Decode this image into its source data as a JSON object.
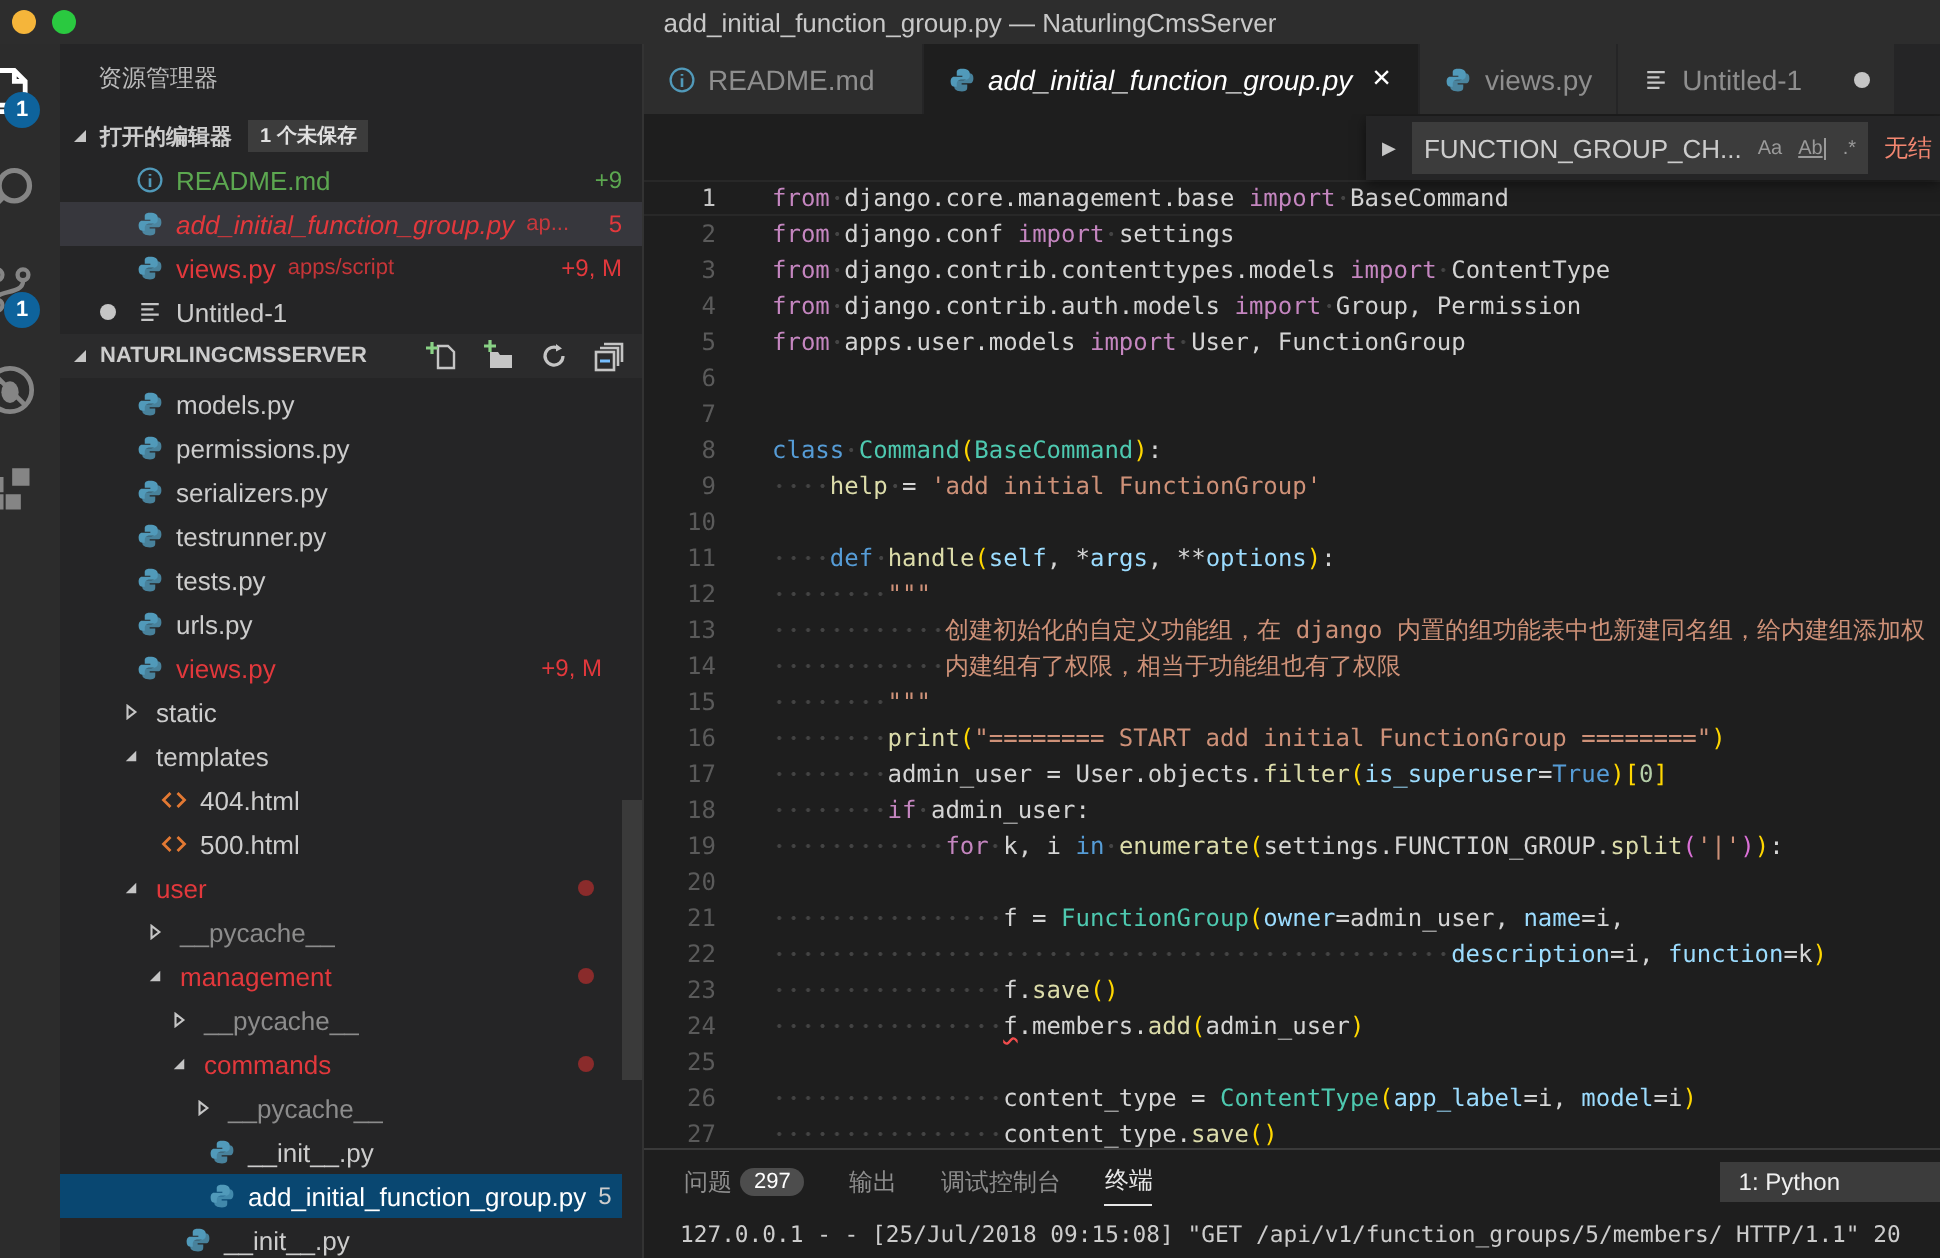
{
  "window": {
    "title": "add_initial_function_group.py — NaturlingCmsServer"
  },
  "activity_bar": [
    {
      "kind": "files",
      "badge": "1",
      "selected": true
    },
    {
      "kind": "search",
      "selected": false
    },
    {
      "kind": "git",
      "badge": "1",
      "selected": false
    },
    {
      "kind": "debug",
      "selected": false
    },
    {
      "kind": "extensions",
      "selected": false
    }
  ],
  "sidebar": {
    "title": "资源管理器",
    "open_editors": {
      "title": "打开的编辑器",
      "badge": "1 个未保存",
      "expanded": true,
      "items": [
        {
          "kind": "info",
          "name": "README.md",
          "added": true,
          "errors": false,
          "decoration": "+9",
          "preview": false,
          "dirty": false,
          "selected": false
        },
        {
          "kind": "python",
          "name": "add_initial_function_group.py",
          "path": "ap...",
          "added": false,
          "errors": true,
          "decoration": "5",
          "preview": true,
          "dirty": false,
          "selected": true
        },
        {
          "kind": "python",
          "name": "views.py",
          "path": "apps/script",
          "added": false,
          "errors": true,
          "decoration": "+9, M",
          "preview": false,
          "dirty": false,
          "selected": false
        },
        {
          "kind": "text",
          "name": "Untitled-1",
          "added": false,
          "errors": false,
          "preview": false,
          "dirty": true,
          "selected": false
        }
      ]
    },
    "project": {
      "title": "NATURLINGCMSSERVER",
      "expanded": true,
      "tree": [
        {
          "kind": "python",
          "name": "models.py",
          "errors": false,
          "ignored": false,
          "selected": false
        },
        {
          "kind": "python",
          "name": "permissions.py",
          "errors": false,
          "ignored": false,
          "selected": false
        },
        {
          "kind": "python",
          "name": "serializers.py",
          "errors": false,
          "ignored": false,
          "selected": false
        },
        {
          "kind": "python",
          "name": "testrunner.py",
          "errors": false,
          "ignored": false,
          "selected": false
        },
        {
          "kind": "python",
          "name": "tests.py",
          "errors": false,
          "ignored": false,
          "selected": false
        },
        {
          "kind": "python",
          "name": "urls.py",
          "errors": false,
          "ignored": false,
          "selected": false
        },
        {
          "kind": "python",
          "name": "views.py",
          "errors": true,
          "ignored": false,
          "decoration": "+9, M",
          "selected": false
        },
        {
          "kind": "folder",
          "name": "static",
          "errors": false,
          "ignored": false,
          "expanded": false,
          "selected": false
        },
        {
          "kind": "folder",
          "name": "templates",
          "errors": false,
          "ignored": false,
          "expanded": true,
          "selected": false,
          "children": [
            {
              "kind": "html",
              "name": "404.html",
              "errors": false,
              "ignored": false,
              "selected": false
            },
            {
              "kind": "html",
              "name": "500.html",
              "errors": false,
              "ignored": false,
              "selected": false
            }
          ]
        },
        {
          "kind": "folder",
          "name": "user",
          "errors": true,
          "ignored": false,
          "expanded": true,
          "selected": false,
          "children": [
            {
              "kind": "folder",
              "name": "__pycache__",
              "errors": false,
              "ignored": true,
              "expanded": false,
              "selected": false
            },
            {
              "kind": "folder",
              "name": "management",
              "errors": true,
              "ignored": false,
              "expanded": true,
              "selected": false,
              "children": [
                {
                  "kind": "folder",
                  "name": "__pycache__",
                  "errors": false,
                  "ignored": true,
                  "expanded": false,
                  "selected": false
                },
                {
                  "kind": "folder",
                  "name": "commands",
                  "errors": true,
                  "ignored": false,
                  "expanded": true,
                  "selected": false,
                  "children": [
                    {
                      "kind": "folder",
                      "name": "__pycache__",
                      "errors": false,
                      "ignored": true,
                      "expanded": false,
                      "selected": false
                    },
                    {
                      "kind": "python",
                      "name": "__init__.py",
                      "errors": false,
                      "ignored": false,
                      "selected": false
                    },
                    {
                      "kind": "python",
                      "name": "add_initial_function_group.py",
                      "errors": false,
                      "ignored": false,
                      "decoration": "5",
                      "selected": true
                    }
                  ]
                },
                {
                  "kind": "python",
                  "name": "__init__.py",
                  "errors": false,
                  "ignored": false,
                  "selected": false
                }
              ]
            }
          ]
        }
      ]
    }
  },
  "tabs": [
    {
      "kind": "info",
      "label": "README.md",
      "selected": false,
      "preview": false,
      "dirty": false
    },
    {
      "kind": "python",
      "label": "add_initial_function_group.py",
      "selected": true,
      "preview": true,
      "dirty": false,
      "close": "×"
    },
    {
      "kind": "python",
      "label": "views.py",
      "selected": false,
      "preview": false,
      "dirty": false
    },
    {
      "kind": "text",
      "label": "Untitled-1",
      "selected": false,
      "preview": false,
      "dirty": true
    }
  ],
  "find_widget": {
    "toggle": "▶",
    "value": "FUNCTION_GROUP_CH...",
    "match_case": "Aa",
    "whole_word": "Ab",
    "regex": ".*",
    "result": "无结"
  },
  "editor": {
    "lines": [
      {
        "n": "1",
        "current": true,
        "tokens": [
          {
            "kind": "kw",
            "t": "from"
          },
          {
            "kind": "t",
            "t": " django.core.management.base "
          },
          {
            "kind": "kw",
            "t": "import"
          },
          {
            "kind": "t",
            "t": " BaseCommand"
          }
        ]
      },
      {
        "n": "2",
        "current": false,
        "tokens": [
          {
            "kind": "kw",
            "t": "from"
          },
          {
            "kind": "t",
            "t": " django.conf "
          },
          {
            "kind": "kw",
            "t": "import"
          },
          {
            "kind": "t",
            "t": " settings"
          }
        ]
      },
      {
        "n": "3",
        "current": false,
        "tokens": [
          {
            "kind": "kw",
            "t": "from"
          },
          {
            "kind": "t",
            "t": " django.contrib.contenttypes.models "
          },
          {
            "kind": "kw",
            "t": "import"
          },
          {
            "kind": "t",
            "t": " ContentType"
          }
        ]
      },
      {
        "n": "4",
        "current": false,
        "tokens": [
          {
            "kind": "kw",
            "t": "from"
          },
          {
            "kind": "t",
            "t": " django.contrib.auth.models "
          },
          {
            "kind": "kw",
            "t": "import"
          },
          {
            "kind": "t",
            "t": " Group, Permission"
          }
        ]
      },
      {
        "n": "5",
        "current": false,
        "tokens": [
          {
            "kind": "kw",
            "t": "from"
          },
          {
            "kind": "t",
            "t": " apps.user.models "
          },
          {
            "kind": "kw",
            "t": "import"
          },
          {
            "kind": "t",
            "t": " User, FunctionGroup"
          }
        ]
      },
      {
        "n": "6",
        "current": false
      },
      {
        "n": "7",
        "current": false
      },
      {
        "n": "8",
        "current": false,
        "tokens": [
          {
            "kind": "st",
            "t": "class"
          },
          {
            "kind": "cls",
            "t": " Command"
          },
          {
            "kind": "b",
            "t": "("
          },
          {
            "kind": "cls",
            "t": "BaseCommand"
          },
          {
            "kind": "b",
            "t": ")"
          },
          {
            "kind": "t",
            "t": ":"
          }
        ]
      },
      {
        "n": "9",
        "current": false,
        "tokens": [
          {
            "kind": "fn",
            "t": "    help"
          },
          {
            "kind": "t",
            "t": " = "
          },
          {
            "kind": "s",
            "t": "'add initial FunctionGroup'"
          }
        ]
      },
      {
        "n": "10",
        "current": false
      },
      {
        "n": "11",
        "current": false,
        "tokens": [
          {
            "kind": "st",
            "t": "    def"
          },
          {
            "kind": "fn",
            "t": " handle"
          },
          {
            "kind": "b",
            "t": "("
          },
          {
            "kind": "p",
            "t": "self"
          },
          {
            "kind": "t",
            "t": ", *"
          },
          {
            "kind": "p",
            "t": "args"
          },
          {
            "kind": "t",
            "t": ", **"
          },
          {
            "kind": "p",
            "t": "options"
          },
          {
            "kind": "b",
            "t": ")"
          },
          {
            "kind": "t",
            "t": ":"
          }
        ]
      },
      {
        "n": "12",
        "current": false,
        "tokens": [
          {
            "kind": "s",
            "t": "        \"\"\""
          }
        ]
      },
      {
        "n": "13",
        "current": false,
        "tokens": [
          {
            "kind": "s",
            "t": "            创建初始化的自定义功能组，在 django 内置的组功能表中也新建同名组，给内建组添加权"
          }
        ]
      },
      {
        "n": "14",
        "current": false,
        "tokens": [
          {
            "kind": "s",
            "t": "            内建组有了权限，相当于功能组也有了权限"
          }
        ]
      },
      {
        "n": "15",
        "current": false,
        "tokens": [
          {
            "kind": "s",
            "t": "        \"\"\""
          }
        ]
      },
      {
        "n": "16",
        "current": false,
        "tokens": [
          {
            "kind": "fn",
            "t": "        print"
          },
          {
            "kind": "b",
            "t": "("
          },
          {
            "kind": "s",
            "t": "\"======== START add initial FunctionGroup ========\""
          },
          {
            "kind": "b",
            "t": ")"
          }
        ]
      },
      {
        "n": "17",
        "current": false,
        "tokens": [
          {
            "kind": "t",
            "t": "        admin_user = User.objects."
          },
          {
            "kind": "fn",
            "t": "filter"
          },
          {
            "kind": "b",
            "t": "("
          },
          {
            "kind": "p",
            "t": "is_superuser"
          },
          {
            "kind": "t",
            "t": "="
          },
          {
            "kind": "st",
            "t": "True"
          },
          {
            "kind": "b",
            "t": ")["
          },
          {
            "kind": "n",
            "t": "0"
          },
          {
            "kind": "b",
            "t": "]"
          }
        ]
      },
      {
        "n": "18",
        "current": false,
        "tokens": [
          {
            "kind": "kw",
            "t": "        if"
          },
          {
            "kind": "t",
            "t": " admin_user:"
          }
        ]
      },
      {
        "n": "19",
        "current": false,
        "tokens": [
          {
            "kind": "kw",
            "t": "            for"
          },
          {
            "kind": "t",
            "t": " k, i "
          },
          {
            "kind": "st",
            "t": "in"
          },
          {
            "kind": "fn",
            "t": " enumerate"
          },
          {
            "kind": "b",
            "t": "("
          },
          {
            "kind": "t",
            "t": "settings.FUNCTION_GROUP."
          },
          {
            "kind": "fn",
            "t": "split"
          },
          {
            "kind": "b2",
            "t": "("
          },
          {
            "kind": "s",
            "t": "'|'"
          },
          {
            "kind": "b2",
            "t": ")"
          },
          {
            "kind": "b",
            "t": ")"
          },
          {
            "kind": "t",
            "t": ":"
          }
        ]
      },
      {
        "n": "20",
        "current": false
      },
      {
        "n": "21",
        "current": false,
        "tokens": [
          {
            "kind": "t",
            "t": "                f = "
          },
          {
            "kind": "cls",
            "t": "FunctionGroup"
          },
          {
            "kind": "b",
            "t": "("
          },
          {
            "kind": "p",
            "t": "owner"
          },
          {
            "kind": "t",
            "t": "=admin_user, "
          },
          {
            "kind": "p",
            "t": "name"
          },
          {
            "kind": "t",
            "t": "=i,"
          }
        ]
      },
      {
        "n": "22",
        "current": false,
        "tokens": [
          {
            "kind": "p",
            "t": "                                               description"
          },
          {
            "kind": "t",
            "t": "=i, "
          },
          {
            "kind": "p",
            "t": "function"
          },
          {
            "kind": "t",
            "t": "=k"
          },
          {
            "kind": "b",
            "t": ")"
          }
        ]
      },
      {
        "n": "23",
        "current": false,
        "tokens": [
          {
            "kind": "t",
            "t": "                f."
          },
          {
            "kind": "fn",
            "t": "save"
          },
          {
            "kind": "b",
            "t": "()"
          }
        ]
      },
      {
        "n": "24",
        "current": false,
        "tokens": [
          {
            "kind": "e",
            "t": "                f"
          },
          {
            "kind": "t",
            "t": ".members."
          },
          {
            "kind": "fn",
            "t": "add"
          },
          {
            "kind": "b",
            "t": "("
          },
          {
            "kind": "t",
            "t": "admin_user"
          },
          {
            "kind": "b",
            "t": ")"
          }
        ]
      },
      {
        "n": "25",
        "current": false
      },
      {
        "n": "26",
        "current": false,
        "tokens": [
          {
            "kind": "t",
            "t": "                content_type = "
          },
          {
            "kind": "cls",
            "t": "ContentType"
          },
          {
            "kind": "b",
            "t": "("
          },
          {
            "kind": "p",
            "t": "app_label"
          },
          {
            "kind": "t",
            "t": "=i, "
          },
          {
            "kind": "p",
            "t": "model"
          },
          {
            "kind": "t",
            "t": "=i"
          },
          {
            "kind": "b",
            "t": ")"
          }
        ]
      },
      {
        "n": "27",
        "current": false,
        "tokens": [
          {
            "kind": "t",
            "t": "                content_type."
          },
          {
            "kind": "fn",
            "t": "save"
          },
          {
            "kind": "b",
            "t": "()"
          }
        ]
      }
    ]
  },
  "panel": {
    "tabs": [
      {
        "label": "问题",
        "badge": "297",
        "selected": false
      },
      {
        "label": "输出",
        "selected": false
      },
      {
        "label": "调试控制台",
        "selected": false
      },
      {
        "label": "终端",
        "selected": true
      }
    ],
    "terminal_select": "1: Python",
    "terminal_lines": [
      "127.0.0.1 - - [25/Jul/2018 09:15:08] \"GET /api/v1/function_groups/5/members/ HTTP/1.1\" 20"
    ]
  }
}
